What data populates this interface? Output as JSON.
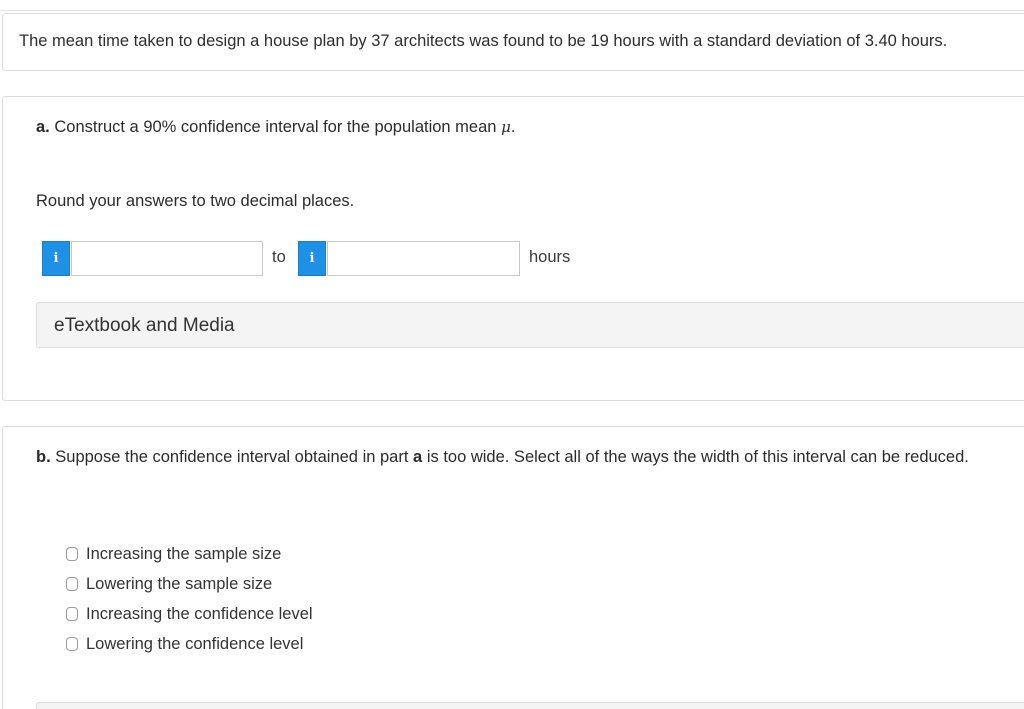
{
  "problem": {
    "stem": "The mean time taken to design a house plan by 37 architects was found to be 19 hours with a standard deviation of 3.40 hours."
  },
  "part_a": {
    "label": "a.",
    "question": "Construct a 90% confidence interval for the population mean",
    "symbol": "μ",
    "period": ".",
    "instruction": "Round your answers to two decimal places.",
    "info_icon_text": "i",
    "lower_value": "",
    "upper_value": "",
    "to_label": "to",
    "unit_label": "hours",
    "resource_label": "eTextbook and Media"
  },
  "part_b": {
    "label": "b.",
    "question_start": "Suppose the confidence interval obtained in part",
    "question_ref": "a",
    "question_end": "is too wide. Select all of the ways the width of this interval can be reduced.",
    "options": [
      {
        "label": "Increasing the sample size",
        "checked": false
      },
      {
        "label": "Lowering the sample size",
        "checked": false
      },
      {
        "label": "Increasing the confidence level",
        "checked": false
      },
      {
        "label": "Lowering the confidence level",
        "checked": false
      }
    ]
  },
  "colors": {
    "info_button": "#1e90e6",
    "text": "#2b2b2b",
    "border": "#dcdcdc"
  }
}
